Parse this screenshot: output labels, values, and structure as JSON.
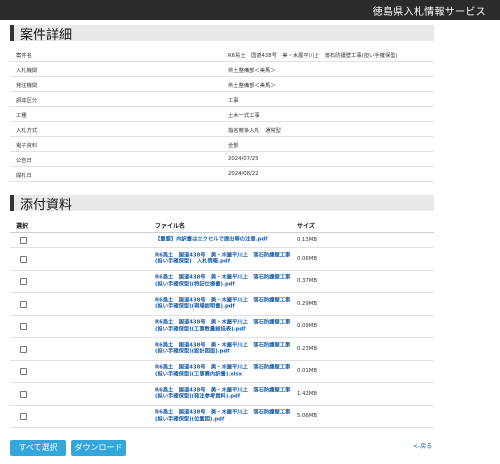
{
  "header": {
    "site_title": "徳島県入札情報サービス"
  },
  "detail": {
    "title": "案件詳細",
    "rows": [
      {
        "label": "案件名",
        "value": "R6鳥土　国道438号　美・木屋平川上　落石防護壁工事(担い手確保型)"
      },
      {
        "label": "入札機関",
        "value": "県土整備部＜美馬＞"
      },
      {
        "label": "発注機関",
        "value": "県土整備部＜美馬＞"
      },
      {
        "label": "調達区分",
        "value": "工事"
      },
      {
        "label": "工種",
        "value": "土木一式工事"
      },
      {
        "label": "入札方式",
        "value": "指名競争入札　通常型"
      },
      {
        "label": "電子資料",
        "value": "全部"
      },
      {
        "label": "公告日",
        "value": "2024/07/25"
      },
      {
        "label": "開札日",
        "value": "2024/08/22"
      }
    ]
  },
  "attachments": {
    "title": "添付資料",
    "columns": {
      "select": "選択",
      "filename": "ファイル名",
      "size": "サイズ"
    },
    "files": [
      {
        "name": "【重要】内訳書はエクセルで提出等の注意.pdf",
        "size": "0.13MB"
      },
      {
        "name": "R6鳥土　国道438号　美・木屋平川上　落石防護壁工事(担い手確保型)　入札情報.pdf",
        "size": "0.06MB"
      },
      {
        "name": "R6鳥土　国道438号　美・木屋平川上　落石防護壁工事(担い手確保型)(特記仕様書).pdf",
        "size": "0.37MB"
      },
      {
        "name": "R6鳥土　国道438号　美・木屋平川上　落石防護壁工事(担い手確保型)(現場説明書).pdf",
        "size": "0.29MB"
      },
      {
        "name": "R6鳥土　国道438号　美・木屋平川上　落石防護壁工事(担い手確保型)(工事数量総括表).pdf",
        "size": "0.09MB"
      },
      {
        "name": "R6鳥土　国道438号　美・木屋平川上　落石防護壁工事(担い手確保型)(設計図面).pdf",
        "size": "0.23MB"
      },
      {
        "name": "R6鳥土　国道438号　美・木屋平川上　落石防護壁工事(担い手確保型)(工事費内訳書).xlsx",
        "size": "0.01MB"
      },
      {
        "name": "R6鳥土　国道438号　美・木屋平川上　落石防護壁工事(担い手確保型)(発注参考資料).pdf",
        "size": "1.42MB"
      },
      {
        "name": "R6鳥土　国道438号　美・木屋平川上　落石防護壁工事(担い手確保型)(位置図).pdf",
        "size": "5.06MB"
      }
    ]
  },
  "actions": {
    "select_all": "すべて選択",
    "download": "ダウンロード",
    "back": "<-戻る"
  },
  "colors": {
    "accent": "#33a6dc",
    "link": "#1a5ea8",
    "topbar": "#2b2b2b"
  }
}
